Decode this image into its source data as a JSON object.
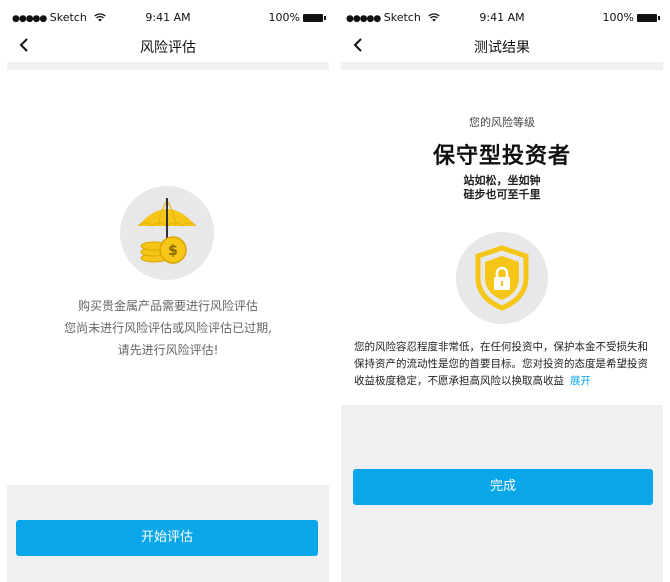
{
  "status_bar": {
    "carrier": "Sketch",
    "time": "9:41 AM",
    "battery": "100%"
  },
  "left": {
    "nav_title": "风险评估",
    "message_lines": [
      "购买贵金属产品需要进行风险评估",
      "您尚未进行风险评估或风险评估已过期,",
      "请先进行风险评估!"
    ],
    "start_button": "开始评估"
  },
  "right": {
    "nav_title": "测试结果",
    "level_label": "您的风险等级",
    "level_value": "保守型投资者",
    "motto_lines": [
      "站如松，坐如钟",
      "硅步也可至千里"
    ],
    "description": "您的风险容忍程度非常低，在任何投资中，保护本金不受损失和保持资产的流动性是您的首要目标。您对投资的态度是希望投资收益极度稳定，不愿承担高风险以换取高收益",
    "expand_link": "展开",
    "done_button": "完成"
  },
  "icons": {
    "back": "chevron-left-icon",
    "wifi": "wifi-icon",
    "signal": "signal-dots-icon",
    "battery": "battery-icon",
    "umbrella": "umbrella-coins-icon",
    "shield": "shield-lock-icon"
  },
  "colors": {
    "accent": "#0aa6ea",
    "icon_yellow": "#f5c518",
    "panel_gray": "#f0f0f3"
  }
}
